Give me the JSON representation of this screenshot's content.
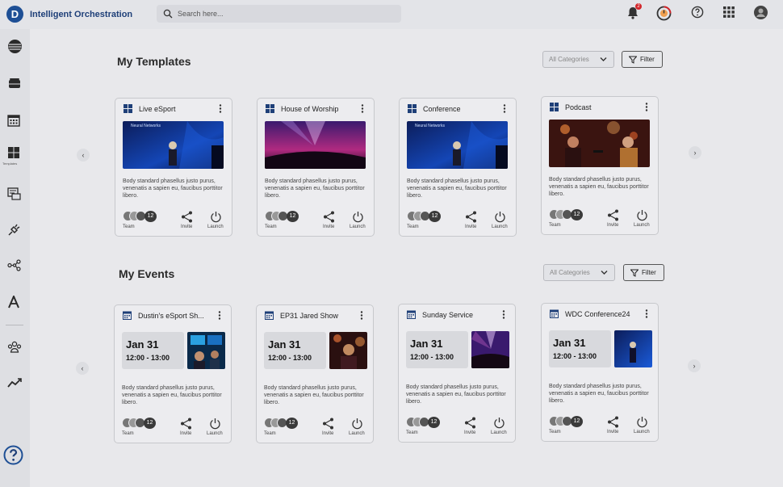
{
  "app": {
    "logo_letter": "D",
    "title": "Intelligent Orchestration"
  },
  "search": {
    "placeholder": "Search here..."
  },
  "topbar": {
    "notification_count": "2",
    "icons": [
      "bell-icon",
      "power-circle-icon",
      "help-icon",
      "apps-grid-icon",
      "profile-avatar"
    ]
  },
  "sidebar": {
    "items": [
      "layers-icon",
      "archive-icon",
      "calendar-icon",
      "templates-icon",
      "playlist-icon",
      "plug-icon",
      "workflow-icon",
      "typography-icon",
      "team-icon",
      "analytics-icon"
    ],
    "tooltip": "Templates",
    "help_icon": "help-icon"
  },
  "templates": {
    "title": "My Templates",
    "category_placeholder": "All Categories",
    "filter_label": "Filter",
    "cards": [
      {
        "title": "Live eSport",
        "thumb_caption": "Neural Networks",
        "desc": "Body standard phasellus justo purus, venenatis a sapien eu, faucibus porttitor libero.",
        "team_count": "12",
        "team_label": "Team",
        "invite_label": "Invite",
        "launch_label": "Launch"
      },
      {
        "title": "House of Worship",
        "thumb_caption": "",
        "desc": "Body standard phasellus justo purus, venenatis a sapien eu, faucibus porttitor libero.",
        "team_count": "12",
        "team_label": "Team",
        "invite_label": "Invite",
        "launch_label": "Launch"
      },
      {
        "title": "Conference",
        "thumb_caption": "Neural Networks",
        "desc": "Body standard phasellus justo purus, venenatis a sapien eu, faucibus porttitor libero.",
        "team_count": "12",
        "team_label": "Team",
        "invite_label": "Invite",
        "launch_label": "Launch"
      },
      {
        "title": "Podcast",
        "thumb_caption": "",
        "desc": "Body standard phasellus justo purus, venenatis a sapien eu, faucibus porttitor libero.",
        "team_count": "12",
        "team_label": "Team",
        "invite_label": "Invite",
        "launch_label": "Launch"
      }
    ]
  },
  "events": {
    "title": "My Events",
    "category_placeholder": "All Categories",
    "filter_label": "Filter",
    "cards": [
      {
        "title": "Dustin's eSport Sh...",
        "date": "Jan 31",
        "time": "12:00 - 13:00",
        "desc": "Body standard phasellus justo purus, venenatis a sapien eu, faucibus porttitor libero.",
        "team_count": "12",
        "team_label": "Team",
        "invite_label": "Invite",
        "launch_label": "Launch"
      },
      {
        "title": "EP31 Jared Show",
        "date": "Jan 31",
        "time": "12:00 - 13:00",
        "desc": "Body standard phasellus justo purus, venenatis a sapien eu, faucibus porttitor libero.",
        "team_count": "12",
        "team_label": "Team",
        "invite_label": "Invite",
        "launch_label": "Launch"
      },
      {
        "title": "Sunday Service",
        "date": "Jan 31",
        "time": "12:00 - 13:00",
        "desc": "Body standard phasellus justo purus, venenatis a sapien eu, faucibus porttitor libero.",
        "team_count": "12",
        "team_label": "Team",
        "invite_label": "Invite",
        "launch_label": "Launch"
      },
      {
        "title": "WDC Conference24",
        "date": "Jan 31",
        "time": "12:00 - 13:00",
        "desc": "Body standard phasellus justo purus, venenatis a sapien eu, faucibus porttitor libero.",
        "team_count": "12",
        "team_label": "Team",
        "invite_label": "Invite",
        "launch_label": "Launch"
      }
    ]
  },
  "colors": {
    "brand": "#1e4f95",
    "notification": "#d2262b",
    "text_dark": "#222222"
  }
}
